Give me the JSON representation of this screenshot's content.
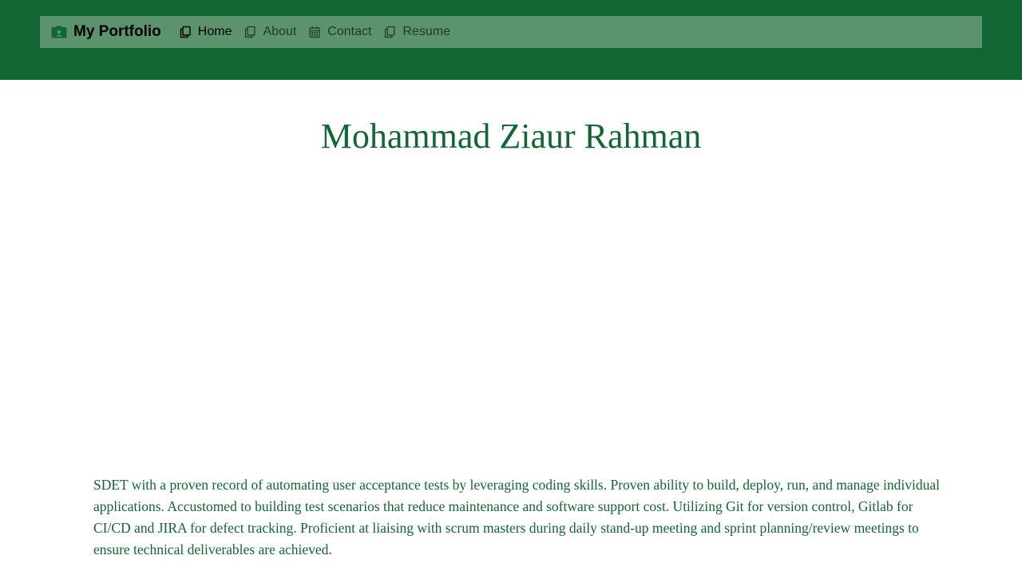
{
  "colors": {
    "accent": "#126634",
    "navbar_bg": "#5b936d",
    "page_bg": "#ffffff"
  },
  "header": {
    "brand": {
      "label": "My Portfolio",
      "icon": "person-card-icon"
    },
    "nav": [
      {
        "label": "Home",
        "icon": "copy-icon",
        "active": true
      },
      {
        "label": "About",
        "icon": "copy-icon",
        "active": false
      },
      {
        "label": "Contact",
        "icon": "calendar-icon",
        "active": false
      },
      {
        "label": "Resume",
        "icon": "copy-icon",
        "active": false
      }
    ]
  },
  "main": {
    "title": "Mohammad Ziaur Rahman",
    "summary": "SDET with a proven record of automating user acceptance tests by leveraging coding skills. Proven ability to build, deploy, run, and manage individual applications. Accustomed to building test scenarios that reduce maintenance and software support cost. Utilizing Git for version control, Gitlab for CI/CD and JIRA for defect tracking. Proficient at liaising with scrum masters during daily stand-up meeting and sprint planning/review meetings to ensure technical deliverables are achieved."
  }
}
